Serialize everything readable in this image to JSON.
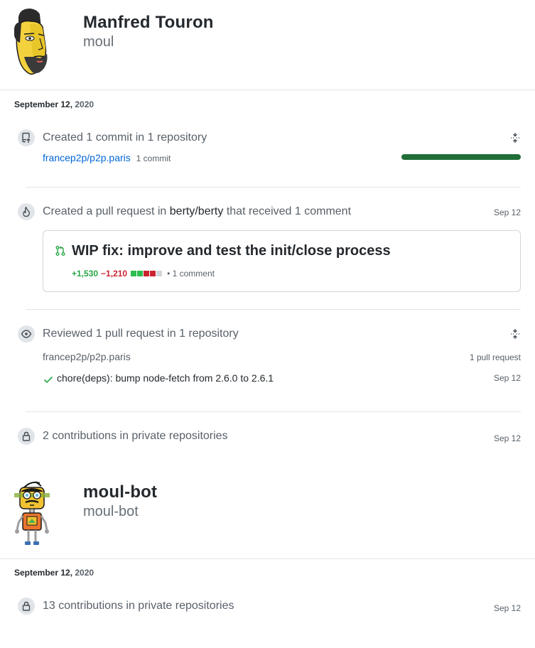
{
  "profiles": [
    {
      "name": "Manfred Touron",
      "login": "moul",
      "date": {
        "month_day": "September 12,",
        "year": " 2020"
      },
      "commits": {
        "title": "Created 1 commit in 1 repository",
        "repo": "francep2p/p2p.paris",
        "count": "1 commit",
        "bar_fraction": 1.0
      },
      "pull_request": {
        "title_prefix": "Created a pull request in ",
        "repo": "berty/berty",
        "title_suffix": " that received 1 comment",
        "date": "Sep 12",
        "pr_title": "WIP fix: improve and test the init/close process",
        "additions": "+1,530",
        "deletions": "−1,210",
        "comments": "• 1 comment",
        "diffstat_colors": [
          "#2cbe4e",
          "#2cbe4e",
          "#cb2431",
          "#cb2431",
          "#d1d5da"
        ]
      },
      "reviews": {
        "title": "Reviewed 1 pull request in 1 repository",
        "repo": "francep2p/p2p.paris",
        "count": "1 pull request",
        "items": [
          {
            "title": "chore(deps): bump node-fetch from 2.6.0 to 2.6.1",
            "date": "Sep 12"
          }
        ]
      },
      "private": {
        "text": "2 contributions in private repositories",
        "date": "Sep 12"
      }
    },
    {
      "name": "moul-bot",
      "login": "moul-bot",
      "date": {
        "month_day": "September 12,",
        "year": " 2020"
      },
      "private": {
        "text": "13 contributions in private repositories",
        "date": "Sep 12"
      }
    }
  ],
  "colors": {
    "link": "#0366d6",
    "progress": "#216e39",
    "addition": "#28a745",
    "deletion": "#cb2431",
    "pr_icon": "#28a745"
  }
}
